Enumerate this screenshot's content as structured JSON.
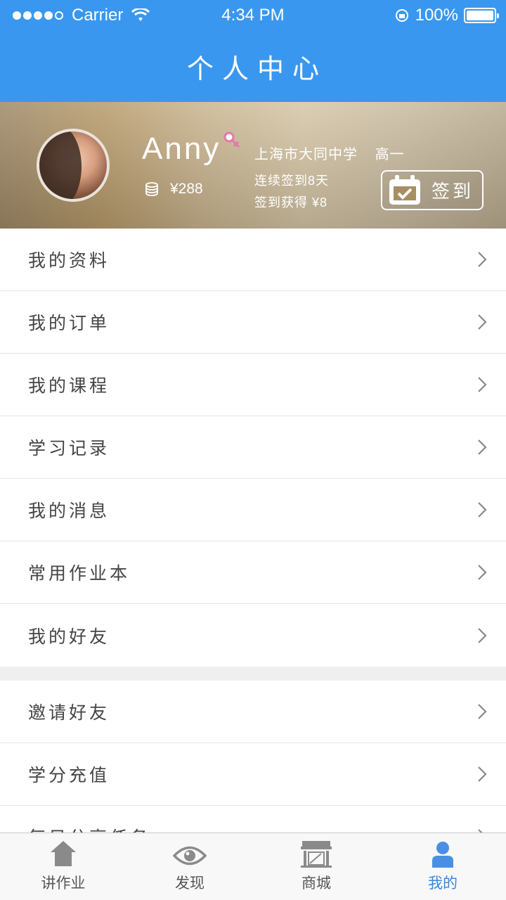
{
  "status_bar": {
    "carrier": "Carrier",
    "time": "4:34 PM",
    "battery": "100%"
  },
  "header": {
    "title": "个人中心"
  },
  "profile": {
    "name": "Anny",
    "coins": "¥288",
    "school": "上海市大同中学",
    "grade": "高一",
    "streak": "连续签到8天",
    "reward": "签到获得 ¥8",
    "signin_label": "签到"
  },
  "menu": [
    {
      "label": "我的资料"
    },
    {
      "label": "我的订单"
    },
    {
      "label": "我的课程"
    },
    {
      "label": "学习记录"
    },
    {
      "label": "我的消息"
    },
    {
      "label": "常用作业本"
    },
    {
      "label": "我的好友"
    }
  ],
  "menu2": [
    {
      "label": "邀请好友"
    },
    {
      "label": "学分充值"
    },
    {
      "label": "每日分享任务"
    }
  ],
  "tabs": [
    {
      "label": "讲作业",
      "icon": "home-icon"
    },
    {
      "label": "发现",
      "icon": "eye-icon"
    },
    {
      "label": "商城",
      "icon": "store-icon"
    },
    {
      "label": "我的",
      "icon": "person-icon",
      "active": true
    }
  ],
  "colors": {
    "primary": "#3a97ef",
    "active_tab": "#3a86d8"
  }
}
